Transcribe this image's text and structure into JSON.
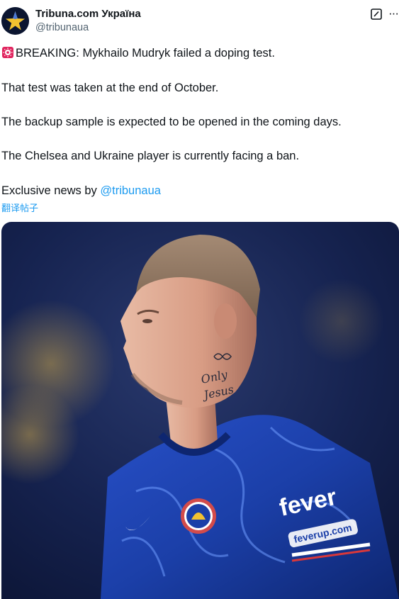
{
  "author": {
    "display_name": "Tribuna.com Україна",
    "handle": "@tribunaua"
  },
  "icons": {
    "avatar": "star-logo-icon",
    "edit": "edit-icon",
    "more": "more-icon",
    "siren": "siren-emoji-icon"
  },
  "tweet": {
    "lines": [
      "BREAKING: Mykhailo Mudryk failed a doping test.",
      "That test was taken at the end of October.",
      "The backup sample is expected to be opened in the coming days.",
      "The Chelsea and Ukraine player is currently facing a ban."
    ],
    "credit_prefix": "Exclusive news by ",
    "credit_mention": "@tribunaua",
    "translate_label": "翻译帖子"
  },
  "photo": {
    "jersey_sponsor": "fever",
    "jersey_sponsor_url": "feverup.com",
    "tattoo_text_1": "Only",
    "tattoo_text_2": "Jesus"
  },
  "colors": {
    "accent": "#1d9bf0",
    "text": "#0f1419",
    "muted": "#536471",
    "jersey": "#1b3fa8"
  }
}
